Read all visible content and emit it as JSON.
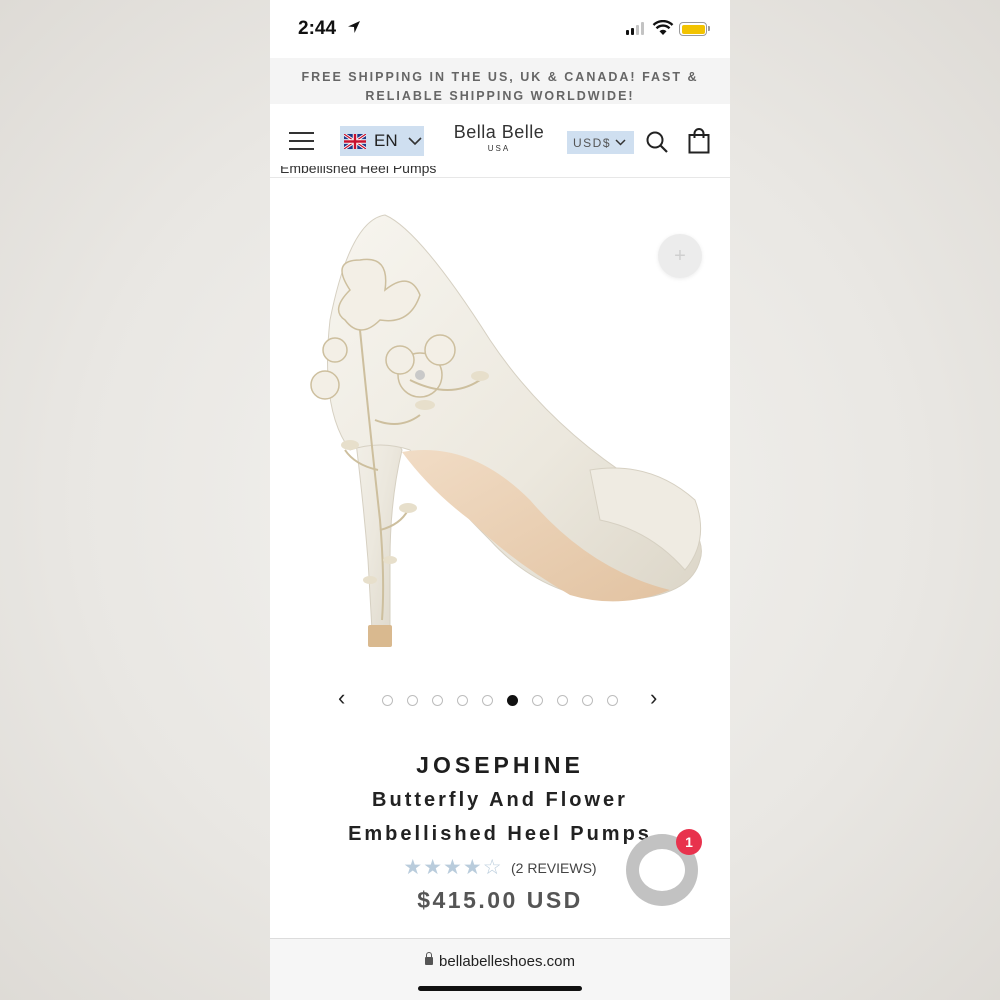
{
  "status_bar": {
    "time": "2:44"
  },
  "promo_banner": {
    "text": "FREE SHIPPING IN THE US, UK & CANADA! FAST & RELIABLE SHIPPING WORLDWIDE!"
  },
  "header": {
    "language": "EN",
    "logo_name": "Bella Belle",
    "logo_sub": "USA",
    "currency": "USD$"
  },
  "breadcrumb": "Embellished Heel Pumps",
  "carousel": {
    "total_slides": 10,
    "active_index": 5
  },
  "product": {
    "brand": "JOSEPHINE",
    "title_line1": "Butterfly And Flower",
    "title_line2": "Embellished Heel Pumps",
    "rating": 4.5,
    "stars": "★★★★☆",
    "reviews": "(2 REVIEWS)",
    "price": "$415.00 USD"
  },
  "chat": {
    "badge_count": "1"
  },
  "browser": {
    "url": "bellabelleshoes.com"
  },
  "colors": {
    "accent_blue": "#cfdff0",
    "badge_red": "#e8324d",
    "battery_yellow": "#f2c300"
  }
}
